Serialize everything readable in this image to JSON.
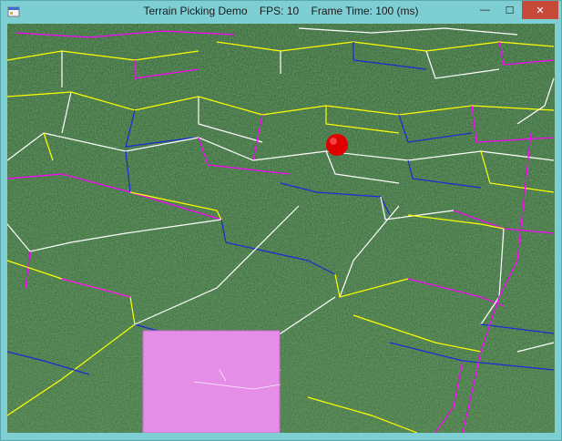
{
  "window": {
    "title": "Terrain Picking Demo    FPS: 10    Frame Time: 100 (ms)",
    "controls": {
      "minimize": "—",
      "maximize": "☐",
      "close": "✕"
    }
  },
  "scene": {
    "terrain_texture": "grass",
    "picked_marker_color": "#e00000",
    "minimap_color": "#e48ee8",
    "grid_line_colors": [
      "#ffff00",
      "#ff00ff",
      "#1a2bd6",
      "#ffffff"
    ]
  }
}
